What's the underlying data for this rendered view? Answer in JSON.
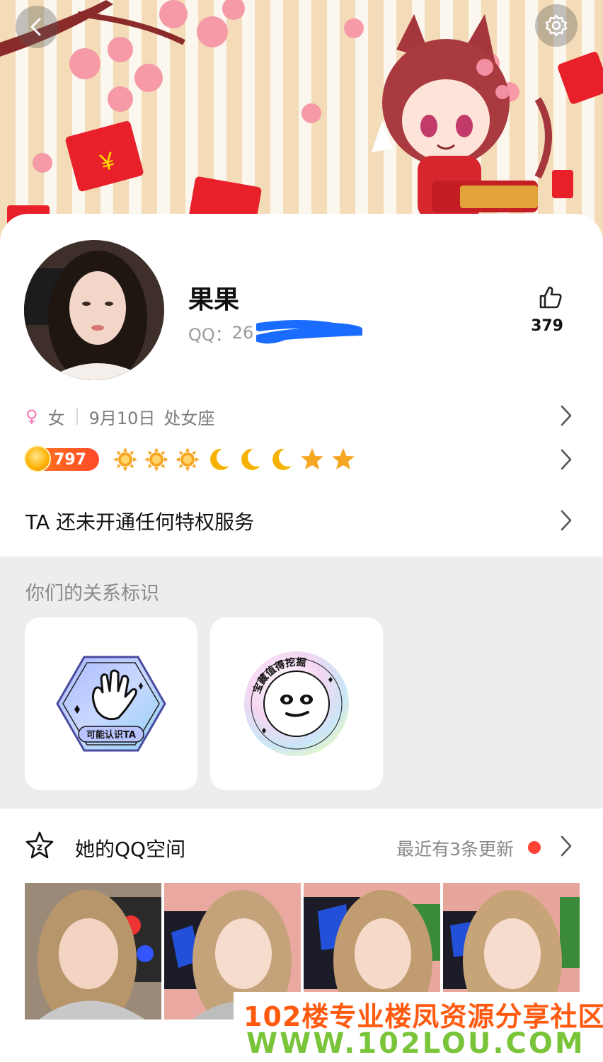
{
  "header": {
    "back_icon": "chevron-left-icon",
    "settings_icon": "gear-icon"
  },
  "profile": {
    "nickname": "果果",
    "qq_prefix": "QQ：",
    "qq_visible": "26",
    "likes": "379",
    "gender_symbol": "♀",
    "gender": "女",
    "birthday": "9月10日",
    "zodiac": "处女座",
    "level": "797",
    "level_icons": [
      "sun",
      "sun",
      "sun",
      "moon",
      "moon",
      "moon",
      "star",
      "star"
    ],
    "privilege": "TA 还未开通任何特权服务"
  },
  "relation": {
    "title": "你们的关系标识",
    "tags": [
      {
        "label": "可能认识TA",
        "icon": "waving-hand-icon"
      },
      {
        "label": "宝藏值得挖掘",
        "icon": "treasure-face-icon"
      }
    ]
  },
  "qzone": {
    "title": "她的QQ空间",
    "update_text": "最近有3条更新"
  },
  "watermark": {
    "line1": "102楼专业楼凤资源分享社区",
    "line2": "WWW.102LOU.COM"
  },
  "colors": {
    "accent_red": "#ff4436",
    "female_pink": "#f47ab0",
    "level_orange": "#ff6a1a"
  }
}
